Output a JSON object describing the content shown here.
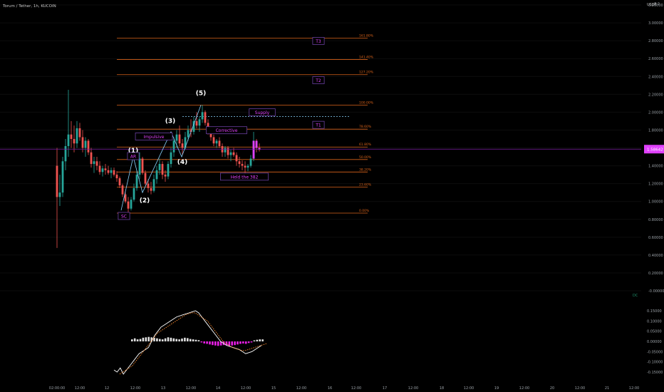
{
  "header": {
    "symbol": "Torum / Tether, 1h, KUCOIN"
  },
  "currency": "USDT",
  "colors": {
    "up": "#26a69a",
    "down": "#ef5350",
    "fib": "#d9631a",
    "label": "#ffffff",
    "magenta": "#e040fb",
    "crosshair": "#7b1fa2",
    "macd": "#ffffff",
    "signal": "#ff8a2b",
    "histUp": "#e0e0e0",
    "histDown": "#e91ee6",
    "supply": "#8ad4ff",
    "bg": "#000000",
    "axisText": "#9aa0a6"
  },
  "price_axis": {
    "ticks": [
      "3.20000",
      "3.00000",
      "2.80000",
      "2.60000",
      "2.40000",
      "2.20000",
      "2.00000",
      "1.80000",
      "1.60000",
      "1.40000",
      "1.20000",
      "1.00000",
      "0.80000",
      "0.60000",
      "0.40000",
      "0.20000",
      "-0.00000"
    ],
    "top_label": "3.2",
    "current_price": "1.58642",
    "ylim": [
      -0.02,
      3.3
    ]
  },
  "macd_axis": {
    "ticks": [
      "0.15000",
      "0.10000",
      "0.05000",
      "0.00000",
      "-0.05000",
      "-0.10000",
      "-0.15000"
    ],
    "ylim": [
      -0.17,
      0.17
    ]
  },
  "time_axis": {
    "labels": [
      "02:00:00",
      "12:00",
      "12",
      "12:00",
      "13",
      "12:00",
      "14",
      "12:00",
      "15",
      "12:00",
      "16",
      "12:00",
      "17",
      "12:00",
      "18",
      "12:00",
      "19",
      "12:00",
      "20",
      "12:00",
      "21",
      "12:00"
    ]
  },
  "chart_data": {
    "type": "candlestick",
    "title": "Torum / Tether, 1h, KUCOIN",
    "fib_levels": [
      {
        "label": "0.00%",
        "price": 0.87
      },
      {
        "label": "23.60%",
        "price": 1.16
      },
      {
        "label": "38.20%",
        "price": 1.33
      },
      {
        "label": "50.00%",
        "price": 1.47
      },
      {
        "label": "61.80%",
        "price": 1.61
      },
      {
        "label": "78.60%",
        "price": 1.81
      },
      {
        "label": "100.00%",
        "price": 2.08
      },
      {
        "label": "127.20%",
        "price": 2.42
      },
      {
        "label": "141.40%",
        "price": 2.59
      },
      {
        "label": "161.80%",
        "price": 2.83
      }
    ],
    "wave_labels": [
      {
        "label": "(1)",
        "price": 1.55
      },
      {
        "label": "(2)",
        "price": 0.99
      },
      {
        "label": "(3)",
        "price": 1.88
      },
      {
        "label": "(4)",
        "price": 1.42
      },
      {
        "label": "(5)",
        "price": 2.19
      }
    ],
    "boxed_labels": [
      {
        "label": "SC",
        "price": 0.83
      },
      {
        "label": "AR",
        "price": 1.5
      },
      {
        "label": "Impulsive",
        "price": 1.72
      },
      {
        "label": "Corrective",
        "price": 1.79
      },
      {
        "label": "Supply",
        "price": 1.99
      },
      {
        "label": "Held the 382",
        "price": 1.27
      },
      {
        "label": "T1",
        "price": 1.85
      },
      {
        "label": "T2",
        "price": 2.35
      },
      {
        "label": "T3",
        "price": 2.79
      }
    ],
    "supply_line": 1.95,
    "current_price": 1.586,
    "candles": [
      [
        1.4,
        1.6,
        0.48,
        1.05
      ],
      [
        1.05,
        1.3,
        0.95,
        1.1
      ],
      [
        1.1,
        1.5,
        1.05,
        1.45
      ],
      [
        1.45,
        1.7,
        1.35,
        1.62
      ],
      [
        1.62,
        2.25,
        1.5,
        1.75
      ],
      [
        1.75,
        1.9,
        1.6,
        1.7
      ],
      [
        1.7,
        1.85,
        1.55,
        1.65
      ],
      [
        1.65,
        1.9,
        1.6,
        1.82
      ],
      [
        1.82,
        1.88,
        1.68,
        1.72
      ],
      [
        1.72,
        1.8,
        1.55,
        1.6
      ],
      [
        1.6,
        1.72,
        1.5,
        1.68
      ],
      [
        1.68,
        1.7,
        1.52,
        1.55
      ],
      [
        1.55,
        1.6,
        1.38,
        1.42
      ],
      [
        1.42,
        1.5,
        1.32,
        1.45
      ],
      [
        1.45,
        1.5,
        1.35,
        1.4
      ],
      [
        1.4,
        1.45,
        1.3,
        1.33
      ],
      [
        1.33,
        1.4,
        1.28,
        1.37
      ],
      [
        1.37,
        1.42,
        1.3,
        1.35
      ],
      [
        1.35,
        1.4,
        1.3,
        1.32
      ],
      [
        1.32,
        1.38,
        1.26,
        1.35
      ],
      [
        1.35,
        1.38,
        1.28,
        1.3
      ],
      [
        1.3,
        1.34,
        1.22,
        1.26
      ],
      [
        1.26,
        1.28,
        1.15,
        1.18
      ],
      [
        1.18,
        1.2,
        1.05,
        1.08
      ],
      [
        1.08,
        1.12,
        0.98,
        1.0
      ],
      [
        1.0,
        1.05,
        0.88,
        0.92
      ],
      [
        0.92,
        1.05,
        0.9,
        1.02
      ],
      [
        1.02,
        1.2,
        1.0,
        1.15
      ],
      [
        1.15,
        1.35,
        1.12,
        1.3
      ],
      [
        1.3,
        1.55,
        1.25,
        1.48
      ],
      [
        1.48,
        1.5,
        1.3,
        1.32
      ],
      [
        1.32,
        1.35,
        1.18,
        1.2
      ],
      [
        1.2,
        1.25,
        1.1,
        1.15
      ],
      [
        1.15,
        1.22,
        1.08,
        1.12
      ],
      [
        1.12,
        1.3,
        1.1,
        1.25
      ],
      [
        1.25,
        1.4,
        1.2,
        1.35
      ],
      [
        1.35,
        1.48,
        1.3,
        1.42
      ],
      [
        1.42,
        1.45,
        1.25,
        1.3
      ],
      [
        1.3,
        1.35,
        1.22,
        1.28
      ],
      [
        1.28,
        1.45,
        1.25,
        1.42
      ],
      [
        1.42,
        1.6,
        1.38,
        1.55
      ],
      [
        1.55,
        1.72,
        1.5,
        1.68
      ],
      [
        1.68,
        1.8,
        1.6,
        1.75
      ],
      [
        1.75,
        1.85,
        1.62,
        1.65
      ],
      [
        1.65,
        1.7,
        1.52,
        1.6
      ],
      [
        1.6,
        1.78,
        1.58,
        1.72
      ],
      [
        1.72,
        1.85,
        1.68,
        1.8
      ],
      [
        1.8,
        1.92,
        1.72,
        1.78
      ],
      [
        1.78,
        1.95,
        1.75,
        1.9
      ],
      [
        1.9,
        2.0,
        1.82,
        1.85
      ],
      [
        1.85,
        1.95,
        1.78,
        1.92
      ],
      [
        1.92,
        2.08,
        1.88,
        2.0
      ],
      [
        2.0,
        2.02,
        1.85,
        1.88
      ],
      [
        1.88,
        1.92,
        1.75,
        1.78
      ],
      [
        1.78,
        1.82,
        1.68,
        1.72
      ],
      [
        1.72,
        1.75,
        1.62,
        1.65
      ],
      [
        1.65,
        1.7,
        1.6,
        1.68
      ],
      [
        1.68,
        1.72,
        1.6,
        1.62
      ],
      [
        1.62,
        1.65,
        1.5,
        1.55
      ],
      [
        1.55,
        1.62,
        1.5,
        1.6
      ],
      [
        1.6,
        1.62,
        1.48,
        1.52
      ],
      [
        1.52,
        1.58,
        1.45,
        1.55
      ],
      [
        1.55,
        1.6,
        1.5,
        1.52
      ],
      [
        1.52,
        1.55,
        1.4,
        1.45
      ],
      [
        1.45,
        1.5,
        1.38,
        1.42
      ],
      [
        1.42,
        1.46,
        1.35,
        1.4
      ],
      [
        1.4,
        1.45,
        1.32,
        1.38
      ],
      [
        1.38,
        1.42,
        1.34,
        1.4
      ],
      [
        1.4,
        1.52,
        1.38,
        1.48
      ],
      [
        1.48,
        1.78,
        1.45,
        1.68
      ],
      [
        1.68,
        1.7,
        1.55,
        1.6
      ],
      [
        1.6,
        1.65,
        1.56,
        1.58
      ]
    ],
    "macd": [
      -0.14,
      -0.15,
      -0.13,
      -0.16,
      -0.14,
      -0.12,
      -0.1,
      -0.08,
      -0.06,
      -0.05,
      -0.04,
      -0.03,
      0.0,
      0.03,
      0.05,
      0.07,
      0.08,
      0.09,
      0.1,
      0.11,
      0.12,
      0.125,
      0.13,
      0.135,
      0.14,
      0.145,
      0.15,
      0.14,
      0.12,
      0.1,
      0.08,
      0.06,
      0.04,
      0.02,
      0.0,
      -0.01,
      -0.02,
      -0.025,
      -0.03,
      -0.035,
      -0.04,
      -0.05,
      -0.06,
      -0.055,
      -0.05,
      -0.04,
      -0.03,
      -0.02
    ],
    "signal": [
      -0.16,
      -0.15,
      -0.14,
      -0.13,
      -0.12,
      -0.1,
      -0.08,
      -0.06,
      -0.04,
      -0.02,
      0.0,
      0.02,
      0.04,
      0.05,
      0.06,
      0.07,
      0.08,
      0.09,
      0.1,
      0.11,
      0.12,
      0.13,
      0.135,
      0.14,
      0.14,
      0.13,
      0.12,
      0.11,
      0.1,
      0.08,
      0.06,
      0.04,
      0.02,
      0.0,
      -0.01,
      -0.02,
      -0.03,
      -0.035,
      -0.04,
      -0.045,
      -0.045,
      -0.04,
      -0.035,
      -0.03,
      -0.025,
      -0.02,
      -0.015,
      -0.01
    ],
    "histogram": [
      0.01,
      0.015,
      0.01,
      0.012,
      0.018,
      0.02,
      0.022,
      0.02,
      0.018,
      0.015,
      0.012,
      0.01,
      0.015,
      0.02,
      0.018,
      0.015,
      0.012,
      0.01,
      0.014,
      0.018,
      0.016,
      0.012,
      0.01,
      0.008,
      0.006,
      -0.005,
      -0.01,
      -0.012,
      -0.015,
      -0.018,
      -0.02,
      -0.022,
      -0.02,
      -0.018,
      -0.02,
      -0.022,
      -0.02,
      -0.018,
      -0.015,
      -0.012,
      -0.01,
      -0.012,
      -0.008,
      -0.005,
      0.005,
      0.008,
      0.01,
      0.01
    ]
  }
}
